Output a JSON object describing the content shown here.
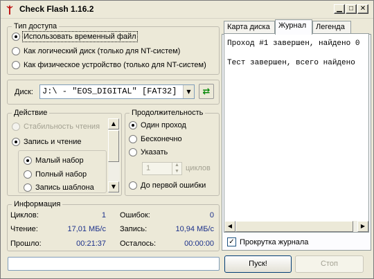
{
  "window": {
    "title": "Check Flash 1.16.2",
    "min_icon": "minimize-icon",
    "max_icon": "maximize-icon",
    "close_icon": "close-icon"
  },
  "access": {
    "title": "Тип доступа",
    "options": [
      "Использовать временный файл",
      "Как логический диск (только для NT-систем)",
      "Как физическое устройство (только для NT-систем)"
    ],
    "selected": 0
  },
  "disk": {
    "label": "Диск:",
    "value": "J:\\ - \"EOS_DIGITAL\" [FAT32]",
    "refresh_icon": "refresh-icon"
  },
  "action": {
    "title": "Действие",
    "options": [
      "Стабильность чтения",
      "Запись и чтение"
    ],
    "selected": 1,
    "sub_options": [
      "Малый набор",
      "Полный набор",
      "Запись шаблона"
    ],
    "sub_selected": 0
  },
  "duration": {
    "title": "Продолжительность",
    "options": [
      "Один проход",
      "Бесконечно",
      "Указать",
      "До первой ошибки"
    ],
    "selected": 0,
    "cycles_value": "1",
    "cycles_label": "циклов"
  },
  "info": {
    "title": "Информация",
    "cycles_label": "Циклов:",
    "cycles_value": "1",
    "errors_label": "Ошибок:",
    "errors_value": "0",
    "read_label": "Чтение:",
    "read_value": "17,01 МБ/с",
    "write_label": "Запись:",
    "write_value": "10,94 МБ/с",
    "elapsed_label": "Прошло:",
    "elapsed_value": "00:21:37",
    "remaining_label": "Осталось:",
    "remaining_value": "00:00:00"
  },
  "tabs": [
    {
      "label": "Карта диска"
    },
    {
      "label": "Журнал"
    },
    {
      "label": "Легенда"
    }
  ],
  "active_tab": 1,
  "log": {
    "lines": [
      "Проход #1 завершен, найдено 0",
      "Тест завершен, всего найдено"
    ]
  },
  "autoscroll": {
    "label": "Прокрутка журнала",
    "checked": true
  },
  "buttons": {
    "start": "Пуск!",
    "stop": "Стоп"
  },
  "progress": {
    "value": 0
  }
}
